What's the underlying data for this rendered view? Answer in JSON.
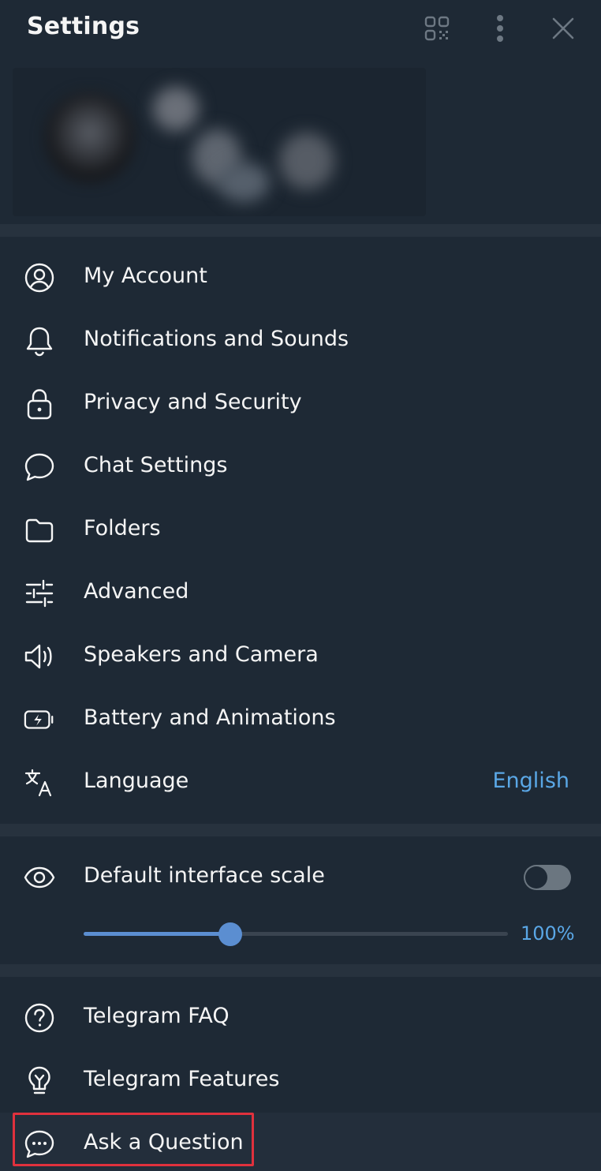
{
  "header": {
    "title": "Settings",
    "icons": [
      "qr-code-icon",
      "more-vertical-icon",
      "close-icon"
    ]
  },
  "colors": {
    "panel_bg": "#1e2935",
    "separator": "#27323e",
    "accent": "#5aa7e6",
    "slider": "#5b8ed1",
    "text": "#f5f5f5",
    "highlight": "#e0313d"
  },
  "menu": {
    "items": [
      {
        "label": "My Account",
        "icon": "account-icon"
      },
      {
        "label": "Notifications and Sounds",
        "icon": "bell-icon"
      },
      {
        "label": "Privacy and Security",
        "icon": "lock-icon"
      },
      {
        "label": "Chat Settings",
        "icon": "chat-bubble-icon"
      },
      {
        "label": "Folders",
        "icon": "folder-icon"
      },
      {
        "label": "Advanced",
        "icon": "sliders-icon"
      },
      {
        "label": "Speakers and Camera",
        "icon": "speaker-icon"
      },
      {
        "label": "Battery and Animations",
        "icon": "battery-icon"
      },
      {
        "label": "Language",
        "icon": "translate-icon",
        "value": "English"
      }
    ]
  },
  "scale": {
    "label": "Default interface scale",
    "icon": "eye-icon",
    "toggle_on": false,
    "slider_fraction": 0.345,
    "value": "100%"
  },
  "help": {
    "items": [
      {
        "label": "Telegram FAQ",
        "icon": "question-circle-icon"
      },
      {
        "label": "Telegram Features",
        "icon": "lightbulb-icon"
      },
      {
        "label": "Ask a Question",
        "icon": "chat-dots-icon"
      }
    ]
  }
}
